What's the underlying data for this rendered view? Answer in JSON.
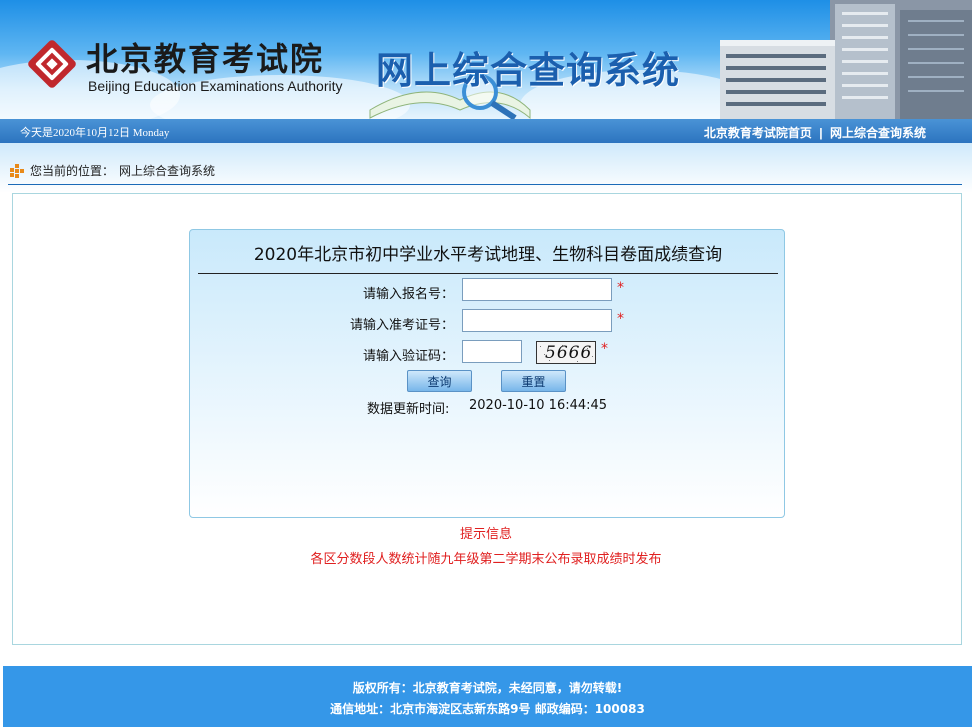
{
  "header": {
    "org_name_cn": "北京教育考试院",
    "org_name_en": "Beijing Education Examinations Authority",
    "system_title": "网上综合查询系统"
  },
  "navbar": {
    "date_text": "今天是2020年10月12日 Monday",
    "links": [
      "北京教育考试院首页",
      "网上综合查询系统"
    ],
    "separator": "|"
  },
  "breadcrumb": {
    "label": "您当前的位置：",
    "current": "网上综合查询系统"
  },
  "query_form": {
    "title": "2020年北京市初中学业水平考试地理、生物科目卷面成绩查询",
    "registration_label": "请输入报名号：",
    "registration_value": "",
    "admission_label": "请输入准考证号：",
    "admission_value": "",
    "captcha_label": "请输入验证码：",
    "captcha_value": "",
    "captcha_image_text": "5666",
    "required_mark": "*",
    "submit_label": "查询",
    "reset_label": "重置",
    "update_label": "数据更新时间:",
    "update_time": "2020-10-10 16:44:45"
  },
  "notice": {
    "title": "提示信息",
    "message": "各区分数段人数统计随九年级第二学期末公布录取成绩时发布"
  },
  "footer": {
    "copyright": "版权所有：北京教育考试院，未经同意，请勿转载!",
    "address": "通信地址：北京市海淀区志新东路9号 邮政编码：100083"
  },
  "colors": {
    "nav_blue": "#2c74bf",
    "footer_blue": "#3597e8",
    "title_blue": "#1b5fae",
    "alert_red": "#e02020",
    "logo_red": "#c0282d"
  }
}
